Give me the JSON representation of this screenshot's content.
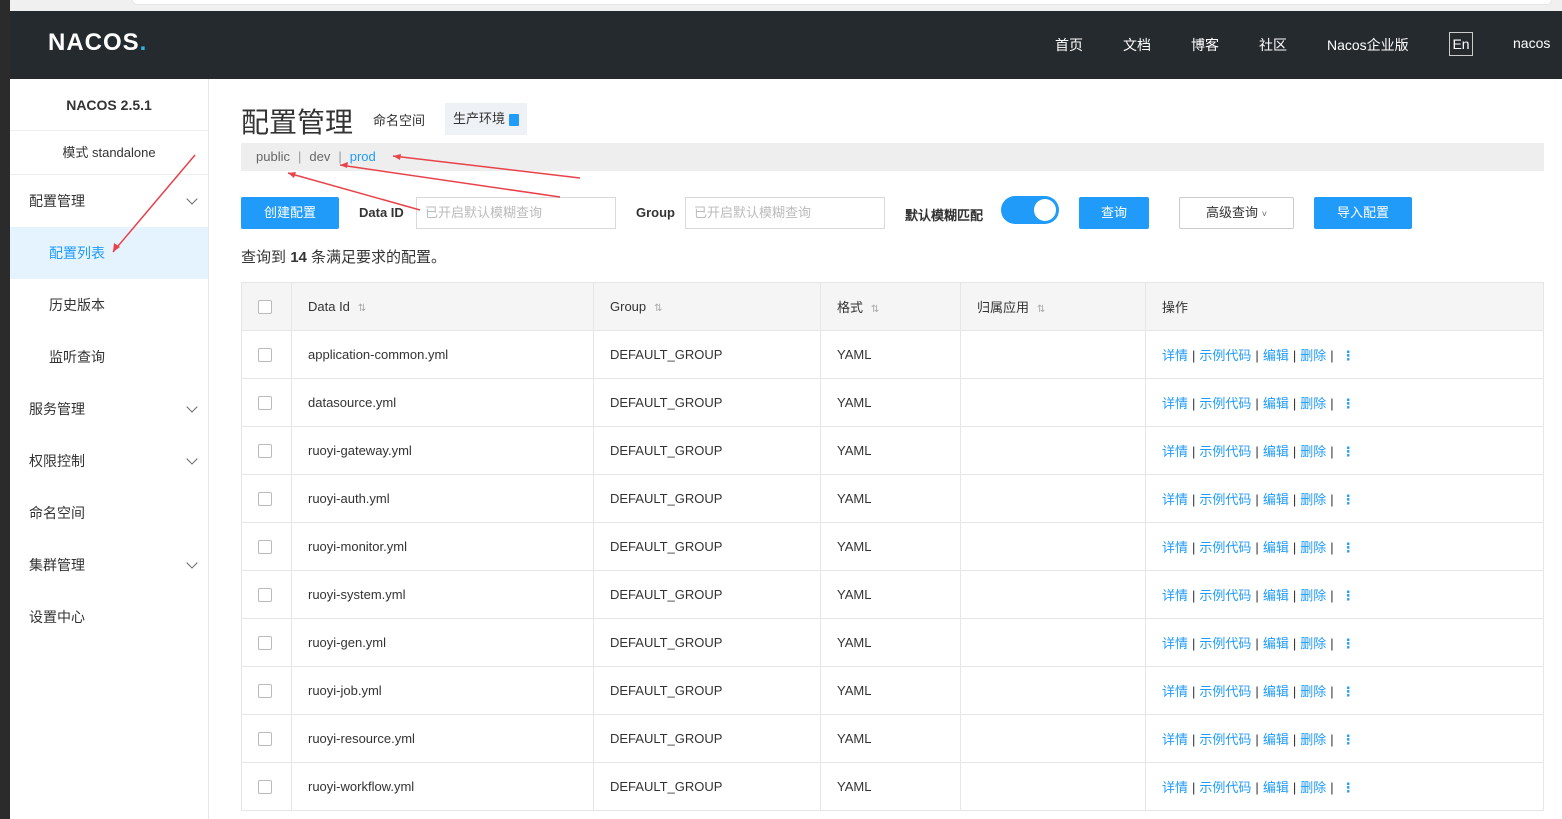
{
  "header": {
    "logo": "NACOS",
    "logo_dot": ".",
    "nav": [
      "首页",
      "文档",
      "博客",
      "社区",
      "Nacos企业版"
    ],
    "lang": "En",
    "user": "nacos"
  },
  "sidebar": {
    "version": "NACOS 2.5.1",
    "mode": "模式 standalone",
    "items": [
      {
        "label": "配置管理"
      },
      {
        "label": "配置列表"
      },
      {
        "label": "历史版本"
      },
      {
        "label": "监听查询"
      },
      {
        "label": "服务管理"
      },
      {
        "label": "权限控制"
      },
      {
        "label": "命名空间"
      },
      {
        "label": "集群管理"
      },
      {
        "label": "设置中心"
      }
    ]
  },
  "main": {
    "title": "配置管理",
    "namespace_label": "命名空间",
    "namespace_tag": "生产环境",
    "namespaces": [
      "public",
      "dev",
      "prod"
    ],
    "create_button": "创建配置",
    "dataid_label": "Data ID",
    "dataid_placeholder": "已开启默认模糊查询",
    "group_label": "Group",
    "group_placeholder": "已开启默认模糊查询",
    "fuzzy_label": "默认模糊匹配",
    "search_button": "查询",
    "advanced_button": "高级查询",
    "import_button": "导入配置",
    "count_prefix": "查询到",
    "count_value": "14",
    "count_suffix": "条满足要求的配置。"
  },
  "table": {
    "columns": [
      "Data Id",
      "Group",
      "格式",
      "归属应用",
      "操作"
    ],
    "actions": [
      "详情",
      "示例代码",
      "编辑",
      "删除"
    ],
    "rows": [
      {
        "data_id": "application-common.yml",
        "group": "DEFAULT_GROUP",
        "format": "YAML",
        "app": ""
      },
      {
        "data_id": "datasource.yml",
        "group": "DEFAULT_GROUP",
        "format": "YAML",
        "app": ""
      },
      {
        "data_id": "ruoyi-gateway.yml",
        "group": "DEFAULT_GROUP",
        "format": "YAML",
        "app": ""
      },
      {
        "data_id": "ruoyi-auth.yml",
        "group": "DEFAULT_GROUP",
        "format": "YAML",
        "app": ""
      },
      {
        "data_id": "ruoyi-monitor.yml",
        "group": "DEFAULT_GROUP",
        "format": "YAML",
        "app": ""
      },
      {
        "data_id": "ruoyi-system.yml",
        "group": "DEFAULT_GROUP",
        "format": "YAML",
        "app": ""
      },
      {
        "data_id": "ruoyi-gen.yml",
        "group": "DEFAULT_GROUP",
        "format": "YAML",
        "app": ""
      },
      {
        "data_id": "ruoyi-job.yml",
        "group": "DEFAULT_GROUP",
        "format": "YAML",
        "app": ""
      },
      {
        "data_id": "ruoyi-resource.yml",
        "group": "DEFAULT_GROUP",
        "format": "YAML",
        "app": ""
      },
      {
        "data_id": "ruoyi-workflow.yml",
        "group": "DEFAULT_GROUP",
        "format": "YAML",
        "app": ""
      }
    ]
  }
}
